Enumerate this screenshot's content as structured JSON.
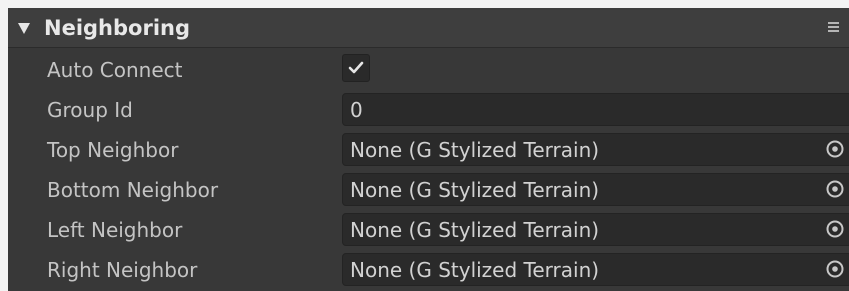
{
  "section": {
    "title": "Neighboring"
  },
  "fields": {
    "auto_connect": {
      "label": "Auto Connect",
      "checked": true
    },
    "group_id": {
      "label": "Group Id",
      "value": "0"
    },
    "top_neighbor": {
      "label": "Top Neighbor",
      "value": "None (G Stylized Terrain)"
    },
    "bottom_neighbor": {
      "label": "Bottom Neighbor",
      "value": "None (G Stylized Terrain)"
    },
    "left_neighbor": {
      "label": "Left Neighbor",
      "value": "None (G Stylized Terrain)"
    },
    "right_neighbor": {
      "label": "Right Neighbor",
      "value": "None (G Stylized Terrain)"
    }
  },
  "icons": {
    "fold": "triangle-down-icon",
    "menu": "menu-icon",
    "checkbox": "checkmark-icon",
    "picker": "object-picker-icon"
  },
  "colors": {
    "panel_bg": "#383838",
    "header_bg": "#3e3e3e",
    "field_bg": "#2a2a2a",
    "text": "#c4c4c4"
  }
}
